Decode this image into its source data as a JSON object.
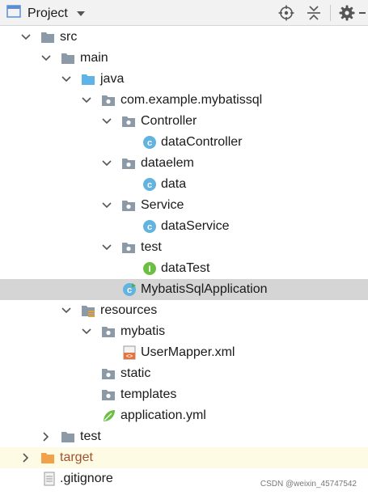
{
  "header": {
    "title": "Project",
    "icons": [
      "project-window-icon",
      "chevron-down-icon",
      "locate-target-icon",
      "collapse-all-icon",
      "settings-gear-icon"
    ]
  },
  "tree": {
    "src": "src",
    "main": "main",
    "java": "java",
    "package": "com.example.mybatissql",
    "controller": "Controller",
    "data_controller": "dataController",
    "dataelem": "dataelem",
    "data": "data",
    "service": "Service",
    "data_service": "dataService",
    "test_pkg": "test",
    "data_test": "dataTest",
    "application": "MybatisSqlApplication",
    "resources": "resources",
    "mybatis": "mybatis",
    "user_mapper": "UserMapper.xml",
    "static": "static",
    "templates": "templates",
    "application_yml": "application.yml",
    "test_dir": "test",
    "target": "target",
    "gitignore": ".gitignore"
  },
  "watermark": "CSDN @weixin_45747542",
  "colors": {
    "folder": "#8c9aa8",
    "source_folder": "#5fb3e6",
    "resources_folder": "#8c9aa8",
    "excluded_folder": "#f0a14a",
    "class_icon": "#63b3e0",
    "interface_icon": "#6cbf43",
    "selection": "#d5d5d5"
  }
}
